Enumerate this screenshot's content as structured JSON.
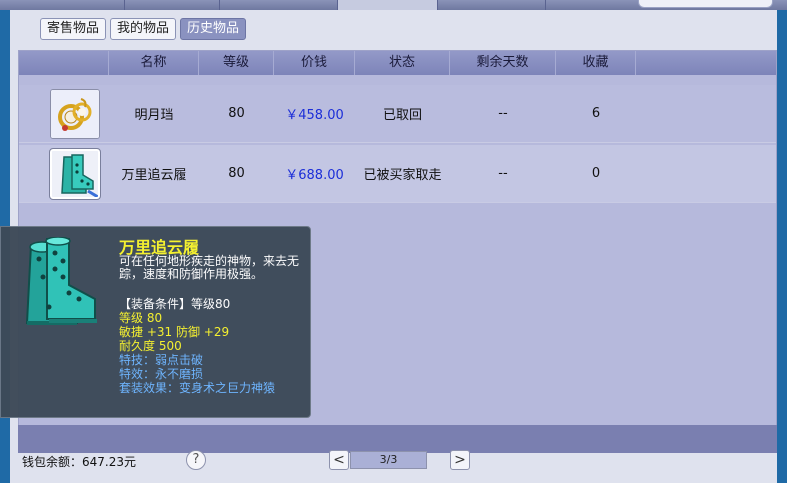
{
  "subtabs": [
    {
      "label": "寄售物品",
      "active": false
    },
    {
      "label": "我的物品",
      "active": false
    },
    {
      "label": "历史物品",
      "active": true
    }
  ],
  "table": {
    "headers": [
      "名称",
      "等级",
      "价钱",
      "状态",
      "剩余天数",
      "收藏"
    ],
    "rows": [
      {
        "icon": "earring-icon",
        "name": "明月珰",
        "level": "80",
        "price": "￥458.00",
        "status": "已取回",
        "days": "--",
        "favorites": "6"
      },
      {
        "icon": "boots-icon",
        "name": "万里追云履",
        "level": "80",
        "price": "￥688.00",
        "status": "已被买家取走",
        "days": "--",
        "favorites": "0"
      }
    ]
  },
  "tooltip": {
    "icon": "boots-icon",
    "title": "万里追云履",
    "description": "可在任何地形疾走的神物，来去无踪，速度和防御作用极强。",
    "requirement": "【装备条件】等级80",
    "stat_level": "等级 80",
    "stat_agility_def": "敏捷 +31 防御 +29",
    "stat_durability": "耐久度 500",
    "skill": "特技：弱点击破",
    "effect": "特效：永不磨损",
    "set_effect": "套装效果：变身术之巨力神猿"
  },
  "footer": {
    "wallet": "钱包余额：647.23元",
    "help": "?",
    "prev": "<",
    "page": "3/3",
    "next": ">"
  },
  "colors": {
    "header_bg": "#8a90c2",
    "price_text": "#1c2ed8",
    "tooltip_title": "#f6f22b",
    "tooltip_stat": "#f6f22b",
    "tooltip_skill": "#6cb4ff"
  }
}
